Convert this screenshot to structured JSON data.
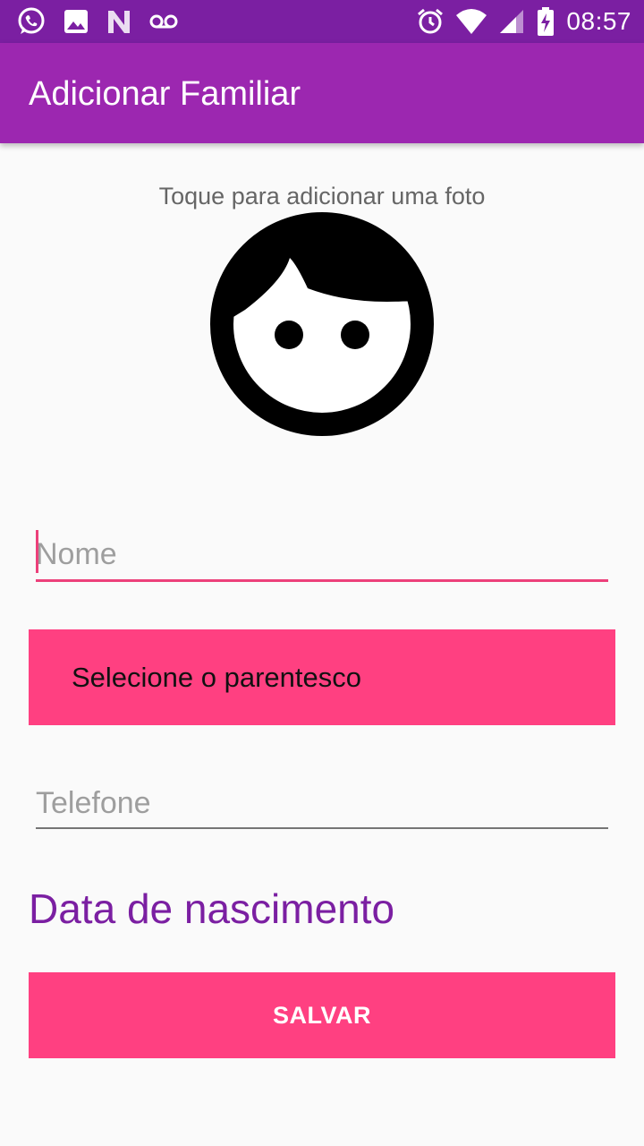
{
  "status_bar": {
    "time": "08:57",
    "left_icons": [
      "whatsapp-icon",
      "image-icon",
      "n-logo-icon",
      "voicemail-icon"
    ],
    "right_icons": [
      "alarm-icon",
      "wifi-icon",
      "signal-icon",
      "battery-charging-icon"
    ]
  },
  "app_bar": {
    "title": "Adicionar Familiar",
    "color": "#9c27b0",
    "status_color": "#7b1fa2"
  },
  "photo": {
    "hint": "Toque para adicionar uma foto",
    "icon": "face-avatar-icon"
  },
  "form": {
    "name_placeholder": "Nome",
    "relationship_label": "Selecione o parentesco",
    "phone_placeholder": "Telefone",
    "birth_date_label": "Data de nascimento",
    "save_label": "SALVAR"
  },
  "colors": {
    "accent": "#ff4081",
    "primary": "#9c27b0",
    "primary_dark": "#7b1fa2"
  }
}
